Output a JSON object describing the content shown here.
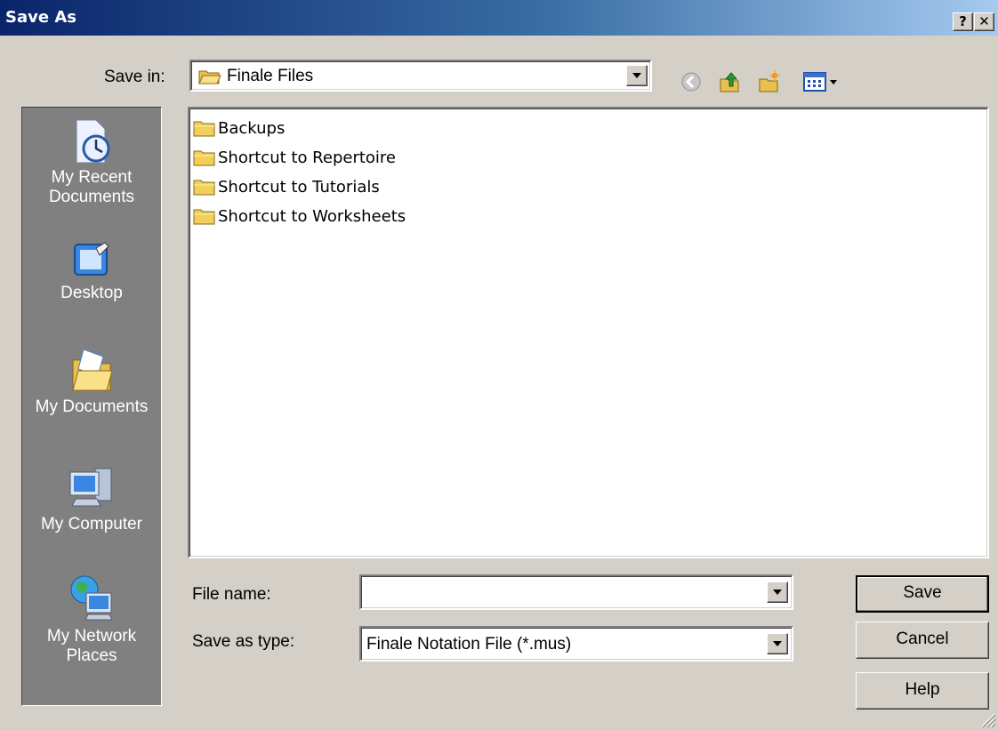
{
  "window": {
    "title": "Save As",
    "help_label": "?",
    "close_label": "✕"
  },
  "save_in": {
    "label": "Save in:",
    "value": "Finale Files"
  },
  "toolbar": {
    "icons": [
      "back-icon",
      "up-folder-icon",
      "new-folder-icon",
      "views-menu-icon"
    ]
  },
  "places": [
    {
      "label_line1": "My Recent",
      "label_line2": "Documents",
      "icon": "recent-documents-icon"
    },
    {
      "label_line1": "Desktop",
      "label_line2": "",
      "icon": "desktop-icon"
    },
    {
      "label_line1": "My Documents",
      "label_line2": "",
      "icon": "my-documents-icon"
    },
    {
      "label_line1": "My Computer",
      "label_line2": "",
      "icon": "my-computer-icon"
    },
    {
      "label_line1": "My Network",
      "label_line2": "Places",
      "icon": "network-places-icon"
    }
  ],
  "files": [
    {
      "name": "Backups"
    },
    {
      "name": "Shortcut to Repertoire"
    },
    {
      "name": "Shortcut to Tutorials"
    },
    {
      "name": "Shortcut to Worksheets"
    }
  ],
  "file_name": {
    "label": "File name:",
    "value": ""
  },
  "save_as_type": {
    "label": "Save as type:",
    "value": "Finale Notation File (*.mus)"
  },
  "buttons": {
    "save": "Save",
    "cancel": "Cancel",
    "help": "Help"
  }
}
